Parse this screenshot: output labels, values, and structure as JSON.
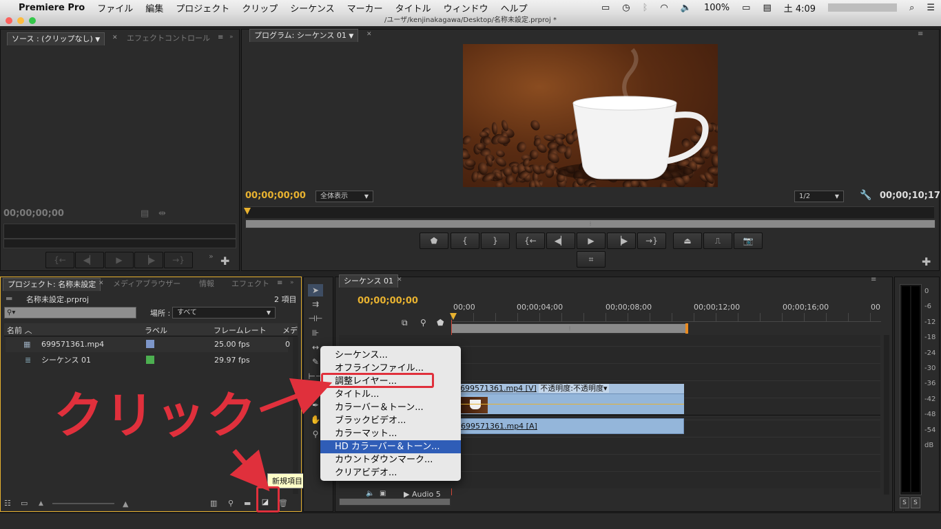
{
  "menubar": {
    "app": "Premiere Pro",
    "items": [
      "ファイル",
      "編集",
      "プロジェクト",
      "クリップ",
      "シーケンス",
      "マーカー",
      "タイトル",
      "ウィンドウ",
      "ヘルプ"
    ],
    "battery": "100%",
    "clock": "土 4:09"
  },
  "window_title": "/ユーザ/kenjinakagawa/Desktop/名称未設定.prproj *",
  "source_panel": {
    "tab_source": "ソース : (クリップなし)",
    "tab_effect_controls": "エフェクトコントロール",
    "timecode": "00;00;00;00"
  },
  "program_panel": {
    "tab": "プログラム: シーケンス 01",
    "timecode_left": "00;00;00;00",
    "zoom": "全体表示",
    "resolution": "1/2",
    "timecode_right": "00;00;10;17"
  },
  "project_panel": {
    "tab_project": "プロジェクト: 名称未設定",
    "tab_media": "メディアブラウザー",
    "tab_info": "情報",
    "tab_effects": "エフェクト",
    "project_file": "名称未設定.prproj",
    "item_count": "2 項目",
    "location_label": "場所 :",
    "location_value": "すべて",
    "columns": [
      "名前",
      "ラベル",
      "フレームレート",
      "メデ"
    ],
    "rows": [
      {
        "name": "699571361.mp4",
        "label_color": "#7d96c9",
        "fps": "25.00 fps",
        "extra": "0"
      },
      {
        "name": "シーケンス 01",
        "label_color": "#4caf50",
        "fps": "29.97 fps",
        "extra": ""
      }
    ]
  },
  "timeline_panel": {
    "tab": "シーケンス 01",
    "timecode": "00;00;00;00",
    "ruler": [
      "00;00",
      "00;00;04;00",
      "00;00;08;00",
      "00;00;12;00",
      "00;00;16;00",
      "00"
    ],
    "video_clip": "699571361.mp4 [V]",
    "opacity_label": "不透明度:不透明度",
    "audio_clip": "699571361.mp4 [A]",
    "audio5": "Audio 5"
  },
  "context_menu": {
    "items": [
      "シーケンス...",
      "オフラインファイル...",
      "調整レイヤー...",
      "タイトル...",
      "カラーバー＆トーン...",
      "ブラックビデオ...",
      "カラーマット...",
      "HD カラーバー＆トーン...",
      "カウントダウンマーク...",
      "クリアビデオ..."
    ],
    "highlighted_index": 7,
    "boxed_index": 2
  },
  "tooltip": "新規項目",
  "annotation": "クリック",
  "meter": {
    "labels": [
      "0",
      "-6",
      "-12",
      "-18",
      "-24",
      "-30",
      "-36",
      "-42",
      "-48",
      "-54",
      "dB"
    ],
    "solo": [
      "S",
      "S"
    ]
  },
  "colors": {
    "accent_timecode": "#e8b230",
    "annotation_red": "#e0303c",
    "menu_highlight": "#2f5db7",
    "clip_blue": "#94b6da"
  }
}
